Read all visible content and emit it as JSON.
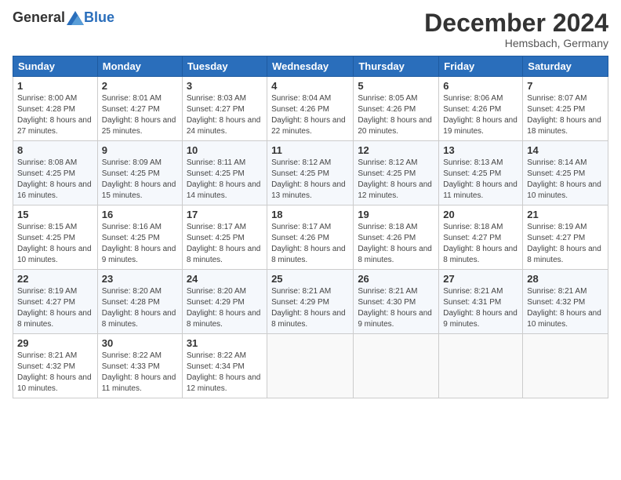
{
  "header": {
    "logo": {
      "general": "General",
      "blue": "Blue"
    },
    "title": "December 2024",
    "location": "Hemsbach, Germany"
  },
  "weekdays": [
    "Sunday",
    "Monday",
    "Tuesday",
    "Wednesday",
    "Thursday",
    "Friday",
    "Saturday"
  ],
  "weeks": [
    [
      {
        "day": "1",
        "sunrise": "8:00 AM",
        "sunset": "4:28 PM",
        "daylight": "8 hours and 27 minutes."
      },
      {
        "day": "2",
        "sunrise": "8:01 AM",
        "sunset": "4:27 PM",
        "daylight": "8 hours and 25 minutes."
      },
      {
        "day": "3",
        "sunrise": "8:03 AM",
        "sunset": "4:27 PM",
        "daylight": "8 hours and 24 minutes."
      },
      {
        "day": "4",
        "sunrise": "8:04 AM",
        "sunset": "4:26 PM",
        "daylight": "8 hours and 22 minutes."
      },
      {
        "day": "5",
        "sunrise": "8:05 AM",
        "sunset": "4:26 PM",
        "daylight": "8 hours and 20 minutes."
      },
      {
        "day": "6",
        "sunrise": "8:06 AM",
        "sunset": "4:26 PM",
        "daylight": "8 hours and 19 minutes."
      },
      {
        "day": "7",
        "sunrise": "8:07 AM",
        "sunset": "4:25 PM",
        "daylight": "8 hours and 18 minutes."
      }
    ],
    [
      {
        "day": "8",
        "sunrise": "8:08 AM",
        "sunset": "4:25 PM",
        "daylight": "8 hours and 16 minutes."
      },
      {
        "day": "9",
        "sunrise": "8:09 AM",
        "sunset": "4:25 PM",
        "daylight": "8 hours and 15 minutes."
      },
      {
        "day": "10",
        "sunrise": "8:11 AM",
        "sunset": "4:25 PM",
        "daylight": "8 hours and 14 minutes."
      },
      {
        "day": "11",
        "sunrise": "8:12 AM",
        "sunset": "4:25 PM",
        "daylight": "8 hours and 13 minutes."
      },
      {
        "day": "12",
        "sunrise": "8:12 AM",
        "sunset": "4:25 PM",
        "daylight": "8 hours and 12 minutes."
      },
      {
        "day": "13",
        "sunrise": "8:13 AM",
        "sunset": "4:25 PM",
        "daylight": "8 hours and 11 minutes."
      },
      {
        "day": "14",
        "sunrise": "8:14 AM",
        "sunset": "4:25 PM",
        "daylight": "8 hours and 10 minutes."
      }
    ],
    [
      {
        "day": "15",
        "sunrise": "8:15 AM",
        "sunset": "4:25 PM",
        "daylight": "8 hours and 10 minutes."
      },
      {
        "day": "16",
        "sunrise": "8:16 AM",
        "sunset": "4:25 PM",
        "daylight": "8 hours and 9 minutes."
      },
      {
        "day": "17",
        "sunrise": "8:17 AM",
        "sunset": "4:25 PM",
        "daylight": "8 hours and 8 minutes."
      },
      {
        "day": "18",
        "sunrise": "8:17 AM",
        "sunset": "4:26 PM",
        "daylight": "8 hours and 8 minutes."
      },
      {
        "day": "19",
        "sunrise": "8:18 AM",
        "sunset": "4:26 PM",
        "daylight": "8 hours and 8 minutes."
      },
      {
        "day": "20",
        "sunrise": "8:18 AM",
        "sunset": "4:27 PM",
        "daylight": "8 hours and 8 minutes."
      },
      {
        "day": "21",
        "sunrise": "8:19 AM",
        "sunset": "4:27 PM",
        "daylight": "8 hours and 8 minutes."
      }
    ],
    [
      {
        "day": "22",
        "sunrise": "8:19 AM",
        "sunset": "4:27 PM",
        "daylight": "8 hours and 8 minutes."
      },
      {
        "day": "23",
        "sunrise": "8:20 AM",
        "sunset": "4:28 PM",
        "daylight": "8 hours and 8 minutes."
      },
      {
        "day": "24",
        "sunrise": "8:20 AM",
        "sunset": "4:29 PM",
        "daylight": "8 hours and 8 minutes."
      },
      {
        "day": "25",
        "sunrise": "8:21 AM",
        "sunset": "4:29 PM",
        "daylight": "8 hours and 8 minutes."
      },
      {
        "day": "26",
        "sunrise": "8:21 AM",
        "sunset": "4:30 PM",
        "daylight": "8 hours and 9 minutes."
      },
      {
        "day": "27",
        "sunrise": "8:21 AM",
        "sunset": "4:31 PM",
        "daylight": "8 hours and 9 minutes."
      },
      {
        "day": "28",
        "sunrise": "8:21 AM",
        "sunset": "4:32 PM",
        "daylight": "8 hours and 10 minutes."
      }
    ],
    [
      {
        "day": "29",
        "sunrise": "8:21 AM",
        "sunset": "4:32 PM",
        "daylight": "8 hours and 10 minutes."
      },
      {
        "day": "30",
        "sunrise": "8:22 AM",
        "sunset": "4:33 PM",
        "daylight": "8 hours and 11 minutes."
      },
      {
        "day": "31",
        "sunrise": "8:22 AM",
        "sunset": "4:34 PM",
        "daylight": "8 hours and 12 minutes."
      },
      null,
      null,
      null,
      null
    ]
  ],
  "labels": {
    "sunrise": "Sunrise:",
    "sunset": "Sunset:",
    "daylight": "Daylight:"
  }
}
